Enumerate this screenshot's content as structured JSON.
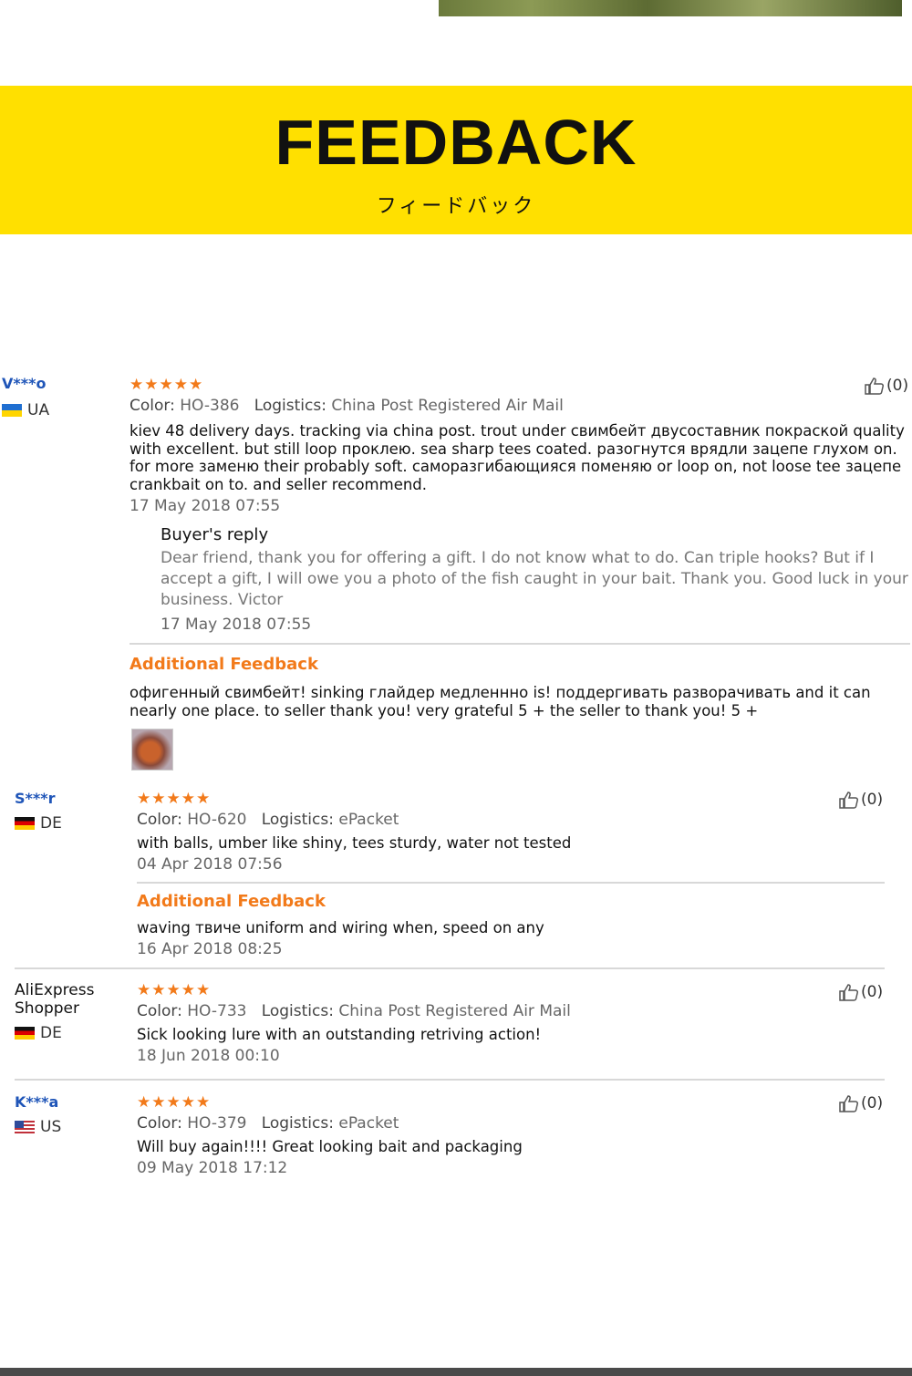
{
  "header": {
    "title": "FEEDBACK",
    "subtitle": "フィードバック"
  },
  "reviews": [
    {
      "user": "V***o",
      "country": "UA",
      "stars": "★★★★★",
      "color_label": "Color:",
      "color": "HO-386",
      "logistics_label": "Logistics:",
      "logistics": "China Post Registered Air Mail",
      "text": "kiev 48 delivery days. tracking via china post. trout under свимбейт двусоставник покраской quality with excellent. but still loop проклею. sea sharp tees coated. разогнутся врядли зацепе глухом on. for more заменю their probably soft. саморазгибающияся поменяю or loop on, not loose tee зацепе crankbait on to. and seller recommend.",
      "date": "17 May 2018 07:55",
      "reply_title": "Buyer's reply",
      "reply_text": "Dear friend, thank you for offering a gift. I do not know what to do. Can triple hooks? But if I accept a gift, I will owe you a photo of the fish caught in your bait. Thank you. Good luck in your business. Victor",
      "reply_date": "17 May 2018 07:55",
      "additional_label": "Additional Feedback",
      "additional_text": "офигенный свимбейт! sinking глайдер медленнно is! поддергивать разворачивать and it can nearly one place. to seller thank you! very grateful 5 + the seller to thank you! 5 +",
      "helpful": "(0)"
    },
    {
      "user": "S***r",
      "country": "DE",
      "stars": "★★★★★",
      "color_label": "Color:",
      "color": "HO-620",
      "logistics_label": "Logistics:",
      "logistics": "ePacket",
      "text": "with balls, umber like shiny, tees sturdy, water not tested",
      "date": "04 Apr 2018 07:56",
      "additional_label": "Additional Feedback",
      "additional_text": "waving твиче uniform and wiring when, speed on any",
      "additional_date": "16 Apr 2018 08:25",
      "helpful": "(0)"
    },
    {
      "user": "AliExpress Shopper",
      "country": "DE",
      "stars": "★★★★★",
      "color_label": "Color:",
      "color": "HO-733",
      "logistics_label": "Logistics:",
      "logistics": "China Post Registered Air Mail",
      "text": "Sick looking lure with an outstanding retriving action!",
      "date": "18 Jun 2018 00:10",
      "helpful": "(0)"
    },
    {
      "user": "K***a",
      "country": "US",
      "stars": "★★★★★",
      "color_label": "Color:",
      "color": "HO-379",
      "logistics_label": "Logistics:",
      "logistics": "ePacket",
      "text": "Will buy again!!!! Great looking bait and packaging",
      "date": "09 May 2018 17:12",
      "helpful": "(0)"
    }
  ]
}
